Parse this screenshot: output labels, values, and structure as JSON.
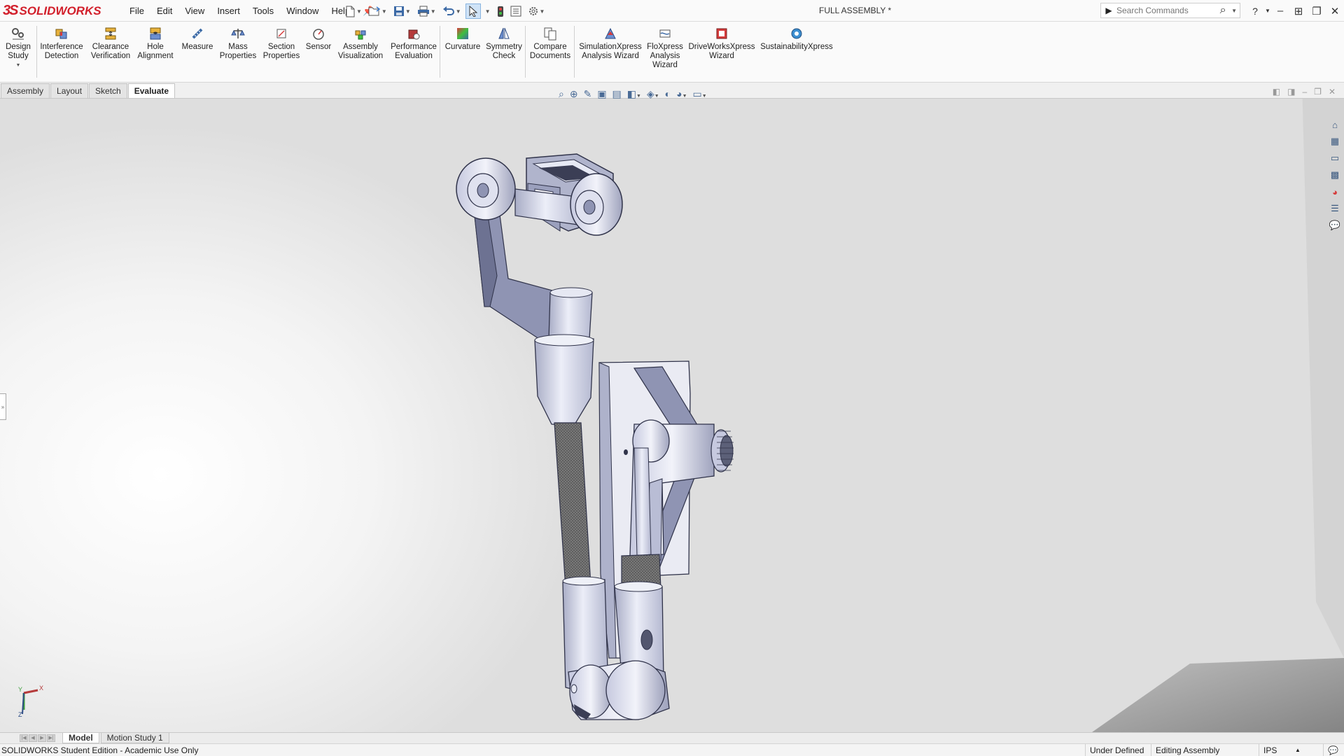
{
  "app": {
    "logo_prefix": "3S",
    "logo_text": "SOLIDWORKS",
    "document_title": "FULL ASSEMBLY *"
  },
  "menu": [
    "File",
    "Edit",
    "View",
    "Insert",
    "Tools",
    "Window",
    "Help"
  ],
  "search": {
    "placeholder": "Search Commands"
  },
  "toolbar": [
    {
      "id": "design-study",
      "label": "Design\nStudy",
      "icon": "design-study-icon"
    },
    {
      "id": "interference-detection",
      "label": "Interference\nDetection",
      "icon": "interference-icon"
    },
    {
      "id": "clearance-verification",
      "label": "Clearance\nVerification",
      "icon": "clearance-icon"
    },
    {
      "id": "hole-alignment",
      "label": "Hole\nAlignment",
      "icon": "hole-alignment-icon"
    },
    {
      "id": "measure",
      "label": "Measure",
      "icon": "measure-icon"
    },
    {
      "id": "mass-properties",
      "label": "Mass\nProperties",
      "icon": "mass-properties-icon"
    },
    {
      "id": "section-properties",
      "label": "Section\nProperties",
      "icon": "section-properties-icon"
    },
    {
      "id": "sensor",
      "label": "Sensor",
      "icon": "sensor-icon"
    },
    {
      "id": "assembly-visualization",
      "label": "Assembly\nVisualization",
      "icon": "assembly-visualization-icon"
    },
    {
      "id": "performance-evaluation",
      "label": "Performance\nEvaluation",
      "icon": "performance-icon"
    },
    {
      "id": "curvature",
      "label": "Curvature",
      "icon": "curvature-icon"
    },
    {
      "id": "symmetry-check",
      "label": "Symmetry\nCheck",
      "icon": "symmetry-icon"
    },
    {
      "id": "compare-documents",
      "label": "Compare\nDocuments",
      "icon": "compare-icon"
    },
    {
      "id": "simulationxpress",
      "label": "SimulationXpress\nAnalysis Wizard",
      "icon": "simulation-icon"
    },
    {
      "id": "floxpress",
      "label": "FloXpress\nAnalysis\nWizard",
      "icon": "floxpress-icon"
    },
    {
      "id": "driveworksxpress",
      "label": "DriveWorksXpress\nWizard",
      "icon": "driveworks-icon"
    },
    {
      "id": "sustainabilityxpress",
      "label": "SustainabilityXpress",
      "icon": "sustainability-icon"
    }
  ],
  "tabs": [
    {
      "label": "Assembly",
      "active": false
    },
    {
      "label": "Layout",
      "active": false
    },
    {
      "label": "Sketch",
      "active": false
    },
    {
      "label": "Evaluate",
      "active": true
    }
  ],
  "bottom_tabs": [
    {
      "label": "Model",
      "active": true
    },
    {
      "label": "Motion Study 1",
      "active": false
    }
  ],
  "status": {
    "edition": "SOLIDWORKS Student Edition - Academic Use Only",
    "definition": "Under Defined",
    "mode": "Editing Assembly",
    "units": "IPS"
  },
  "triad": {
    "x_label": "X",
    "y_label": "Y",
    "z_label": "Z"
  },
  "colors": {
    "brand": "#d21f2b",
    "part": "#d8dcef",
    "active_tab": "#ffffff"
  }
}
